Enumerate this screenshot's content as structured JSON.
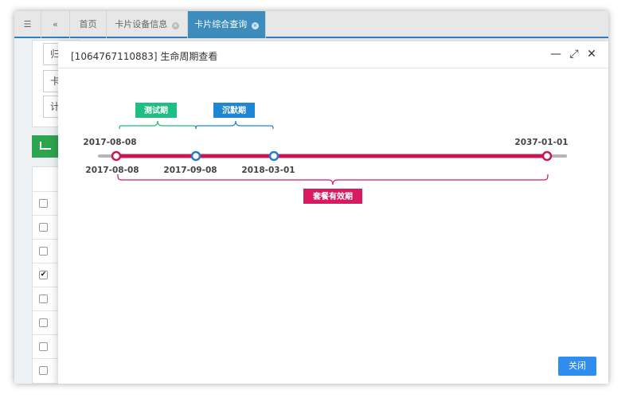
{
  "tabs": [
    {
      "label": "首页",
      "closable": false,
      "active": false
    },
    {
      "label": "卡片设备信息",
      "closable": true,
      "active": false
    },
    {
      "label": "卡片综合查询",
      "closable": true,
      "active": true
    }
  ],
  "background": {
    "field_labels": [
      "归",
      "卡",
      "计"
    ],
    "checked_row_index": 3
  },
  "modal": {
    "title": "[1064767110883] 生命周期查看",
    "close_label": "关闭"
  },
  "timeline": {
    "start_top_date": "2017-08-08",
    "end_top_date": "2037-01-01",
    "points": [
      {
        "date": "2017-08-08",
        "color": "#c8174f"
      },
      {
        "date": "2017-09-08",
        "color": "#2a77c9"
      },
      {
        "date": "2018-03-01",
        "color": "#2a77c9"
      },
      {
        "date": "2037-01-01",
        "color": "#c8174f"
      }
    ],
    "phases": [
      {
        "label": "测试期",
        "color": "#1fbf83"
      },
      {
        "label": "沉默期",
        "color": "#1f86d6"
      },
      {
        "label": "套餐有效期",
        "color": "#d81b60"
      }
    ],
    "line_color": "#c8174f",
    "track_color": "#bdb3b3"
  }
}
